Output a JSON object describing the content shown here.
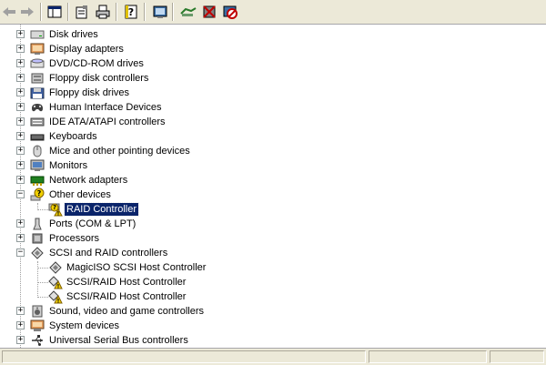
{
  "toolbar": {
    "buttons": [
      "back-icon",
      "forward-icon",
      "show-hide-console-tree-icon",
      "properties-icon",
      "print-icon",
      "help-icon",
      "scan-hardware-changes-icon",
      "update-driver-icon",
      "disable-device-icon",
      "uninstall-device-icon"
    ]
  },
  "tree": {
    "items": [
      {
        "label": "Disk drives",
        "icon": "disk-drive-icon",
        "expanded": false
      },
      {
        "label": "Display adapters",
        "icon": "display-adapter-icon",
        "expanded": false
      },
      {
        "label": "DVD/CD-ROM drives",
        "icon": "dvd-drive-icon",
        "expanded": false
      },
      {
        "label": "Floppy disk controllers",
        "icon": "floppy-controller-icon",
        "expanded": false
      },
      {
        "label": "Floppy disk drives",
        "icon": "floppy-drive-icon",
        "expanded": false
      },
      {
        "label": "Human Interface Devices",
        "icon": "hid-icon",
        "expanded": false
      },
      {
        "label": "IDE ATA/ATAPI controllers",
        "icon": "ide-controller-icon",
        "expanded": false
      },
      {
        "label": "Keyboards",
        "icon": "keyboard-icon",
        "expanded": false
      },
      {
        "label": "Mice and other pointing devices",
        "icon": "mouse-icon",
        "expanded": false
      },
      {
        "label": "Monitors",
        "icon": "monitor-icon",
        "expanded": false
      },
      {
        "label": "Network adapters",
        "icon": "network-adapter-icon",
        "expanded": false
      },
      {
        "label": "Other devices",
        "icon": "unknown-device-icon",
        "expanded": true,
        "children": [
          {
            "label": "RAID Controller",
            "icon": "warning-device-icon",
            "selected": true
          }
        ]
      },
      {
        "label": "Ports (COM & LPT)",
        "icon": "port-icon",
        "expanded": false
      },
      {
        "label": "Processors",
        "icon": "processor-icon",
        "expanded": false
      },
      {
        "label": "SCSI and RAID controllers",
        "icon": "scsi-controller-icon",
        "expanded": true,
        "children": [
          {
            "label": "MagicISO SCSI Host Controller",
            "icon": "scsi-controller-icon"
          },
          {
            "label": "SCSI/RAID Host Controller",
            "icon": "warning-scsi-icon"
          },
          {
            "label": "SCSI/RAID Host Controller",
            "icon": "warning-scsi-icon"
          }
        ]
      },
      {
        "label": "Sound, video and game controllers",
        "icon": "sound-icon",
        "expanded": false
      },
      {
        "label": "System devices",
        "icon": "system-devices-icon",
        "expanded": false
      },
      {
        "label": "Universal Serial Bus controllers",
        "icon": "usb-icon",
        "expanded": false
      }
    ]
  },
  "colors": {
    "selection": "#0a246a",
    "toolbar_bg": "#ece9d8",
    "tree_lines": "#a0a0a0"
  }
}
